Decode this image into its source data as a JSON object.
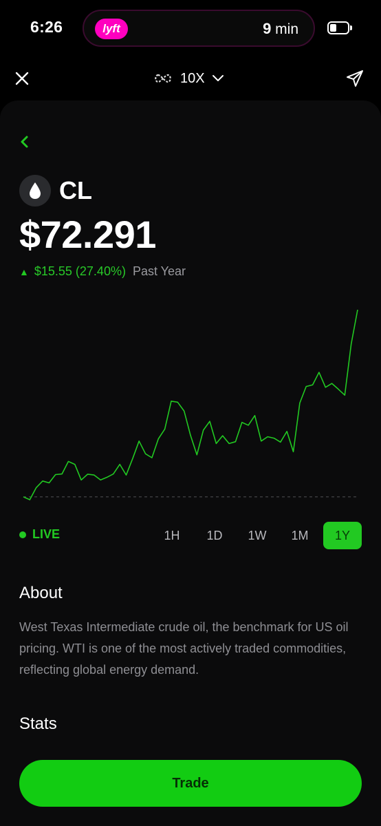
{
  "status_bar": {
    "time": "6:26",
    "activity_app": "lyft",
    "eta_number": "9",
    "eta_unit": "min",
    "battery_level": 0.25
  },
  "nav": {
    "leverage_label": "10X",
    "close_icon": "close-icon",
    "share_icon": "paper-plane-icon",
    "leverage_icon": "infinity-icon"
  },
  "asset": {
    "ticker": "CL",
    "icon": "oil-drop-icon",
    "price": "$72.291",
    "change_text": "$15.55 (27.40%)",
    "period": "Past Year"
  },
  "chart_data": {
    "type": "line",
    "color": "#22c922",
    "baseline_dashed": true,
    "y": [
      72.7,
      71.3,
      77.2,
      80.4,
      79.5,
      83.5,
      83.8,
      89.9,
      88.5,
      80.9,
      83.7,
      83.3,
      80.9,
      82.2,
      83.8,
      88.5,
      83.3,
      91.3,
      99.8,
      93.6,
      91.7,
      100.9,
      105.6,
      119.2,
      118.7,
      114.4,
      102.6,
      93.1,
      105.1,
      109.4,
      98.6,
      102.4,
      98.6,
      99.5,
      108.9,
      107.5,
      112.2,
      99.8,
      101.9,
      101.2,
      99.3,
      104.5,
      94.6,
      118.3,
      126.3,
      127.1,
      133.2,
      125.9,
      127.8,
      125.0,
      122.1,
      147.0,
      163.6
    ],
    "baseline": 72.7
  },
  "controls": {
    "live_label": "LIVE",
    "ranges": [
      "1H",
      "1D",
      "1W",
      "1M",
      "1Y"
    ],
    "active_range": "1Y"
  },
  "about": {
    "title": "About",
    "body": "West Texas Intermediate crude oil, the benchmark for US oil pricing. WTI is one of the most actively traded commodities, reflecting global energy demand."
  },
  "stats": {
    "title": "Stats"
  },
  "trade": {
    "label": "Trade"
  },
  "colors": {
    "accent": "#22c922",
    "lyft": "#ff00bf",
    "background": "#000000",
    "card": "#0b0b0c"
  }
}
